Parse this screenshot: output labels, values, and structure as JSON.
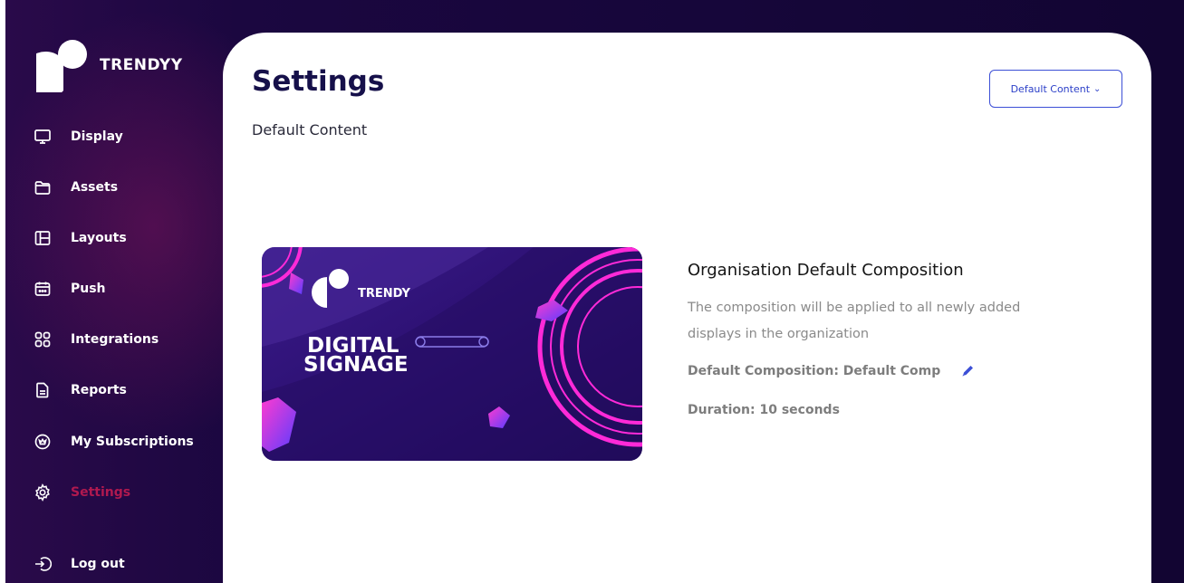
{
  "brand": {
    "name": "TRENDYY",
    "logo_icon": "trendyy-logo-icon"
  },
  "sidebar": {
    "items": [
      {
        "label": "Display",
        "icon": "monitor-icon",
        "active": false
      },
      {
        "label": "Assets",
        "icon": "folder-icon",
        "active": false
      },
      {
        "label": "Layouts",
        "icon": "layout-icon",
        "active": false
      },
      {
        "label": "Push",
        "icon": "calendar-icon",
        "active": false
      },
      {
        "label": "Integrations",
        "icon": "grid-icon",
        "active": false
      },
      {
        "label": "Reports",
        "icon": "document-icon",
        "active": false
      },
      {
        "label": "My Subscriptions",
        "icon": "badge-icon",
        "active": false
      },
      {
        "label": "Settings",
        "icon": "gear-icon",
        "active": true
      }
    ],
    "logout": {
      "label": "Log out",
      "icon": "logout-icon"
    }
  },
  "main": {
    "title": "Settings",
    "subtitle": "Default Content",
    "dropdown": {
      "selected": "Default Content",
      "icon": "chevron-down-icon"
    },
    "thumbnail": {
      "brand": "TRENDY",
      "line1": "DIGITAL",
      "line2": "SIGNAGE"
    },
    "composition": {
      "title": "Organisation Default Composition",
      "description": "The composition will be applied to all newly added displays in the organization",
      "default_label": "Default Composition: Default Comp",
      "duration_label": "Duration: 10 seconds",
      "edit_icon": "pencil-icon"
    }
  },
  "colors": {
    "accent": "#3c4fd6",
    "active_nav": "#b0194f",
    "title": "#16104a",
    "background": "#130634"
  }
}
